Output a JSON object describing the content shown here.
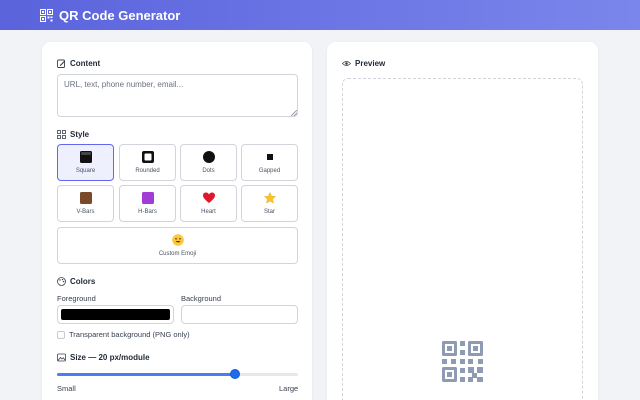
{
  "app": {
    "title": "QR Code Generator",
    "logo_icon": "qr-code-icon"
  },
  "colors": {
    "brand_start": "#5b63dc",
    "brand_end": "#7b86ec",
    "accent": "#6366f1",
    "slider": "#1f6bf0"
  },
  "content": {
    "heading": "Content",
    "icon": "edit-icon",
    "placeholder": "URL, text, phone number, email...",
    "value": ""
  },
  "style": {
    "heading": "Style",
    "icon": "grid-icon",
    "selected": "Square",
    "options": [
      {
        "label": "Square",
        "icon": "square-icon"
      },
      {
        "label": "Rounded",
        "icon": "rounded-square-icon"
      },
      {
        "label": "Dots",
        "icon": "dot-icon"
      },
      {
        "label": "Gapped",
        "icon": "gapped-square-icon"
      },
      {
        "label": "V-Bars",
        "icon": "brown-square-emoji"
      },
      {
        "label": "H-Bars",
        "icon": "purple-square-emoji"
      },
      {
        "label": "Heart",
        "icon": "heart-emoji"
      },
      {
        "label": "Star",
        "icon": "star-emoji"
      },
      {
        "label": "Custom Emoji",
        "icon": "smiley-emoji"
      }
    ]
  },
  "color_section": {
    "heading": "Colors",
    "icon": "palette-icon",
    "foreground_label": "Foreground",
    "foreground_value": "#000000",
    "background_label": "Background",
    "background_value": "#ffffff",
    "transparent_label": "Transparent background (PNG only)",
    "transparent_checked": false
  },
  "size": {
    "heading": "Size — 20 px/module",
    "icon": "image-icon",
    "value": 20,
    "fraction": 0.74,
    "min_label": "Small",
    "max_label": "Large"
  },
  "preview": {
    "heading": "Preview",
    "icon": "eye-icon",
    "placeholder_icon": "qr-code-icon"
  }
}
